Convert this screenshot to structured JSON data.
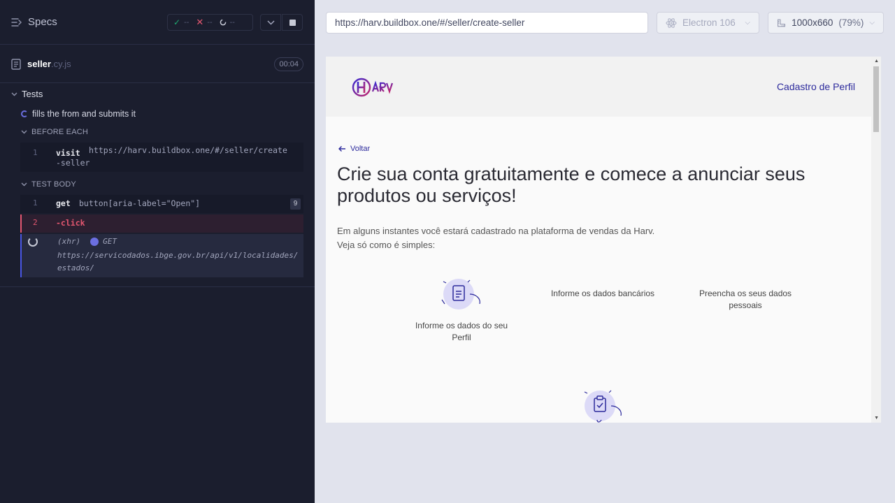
{
  "reporter": {
    "specs_label": "Specs",
    "stats": {
      "passed": "--",
      "failed": "--",
      "pending": "--"
    },
    "spec": {
      "name": "seller",
      "ext": ".cy.js",
      "duration": "00:04"
    },
    "tests_label": "Tests",
    "test_title": "fills the from and submits it",
    "before_each_label": "BEFORE EACH",
    "test_body_label": "TEST BODY",
    "commands": {
      "visit": {
        "num": "1",
        "name": "visit",
        "line1": "https://harv.buildbox.one/#/seller/create",
        "line2": "-seller"
      },
      "get": {
        "num": "1",
        "name": "get",
        "selector": "button[aria-label=\"Open\"]",
        "count": "9"
      },
      "click": {
        "num": "2",
        "name": "-click"
      },
      "xhr": {
        "type": "(xhr)",
        "method": "GET",
        "url": "https://servicodados.ibge.gov.br/api/v1/localidades/estados/"
      }
    }
  },
  "browser": {
    "url": "https://harv.buildbox.one/#/seller/create-seller",
    "browser_name": "Electron 106",
    "viewport": "1000x660",
    "zoom": "(79%)"
  },
  "app": {
    "header_link": "Cadastro de Perfil",
    "back_label": "Voltar",
    "headline": "Crie sua conta gratuitamente e comece a anunciar seus produtos ou serviços!",
    "intro_line1": "Em alguns instantes você estará cadastrado na plataforma de vendas da Harv.",
    "intro_line2": "Veja só como é simples:",
    "steps": [
      {
        "label": "Informe os dados do seu Perfil"
      },
      {
        "label": "Informe os dados bancários"
      },
      {
        "label": "Preencha os seus dados pessoais"
      }
    ]
  },
  "colors": {
    "accent": "#2c2a9c",
    "reporter_bg": "#1b1e2e",
    "fail": "#e45770",
    "pass": "#1fa971"
  }
}
